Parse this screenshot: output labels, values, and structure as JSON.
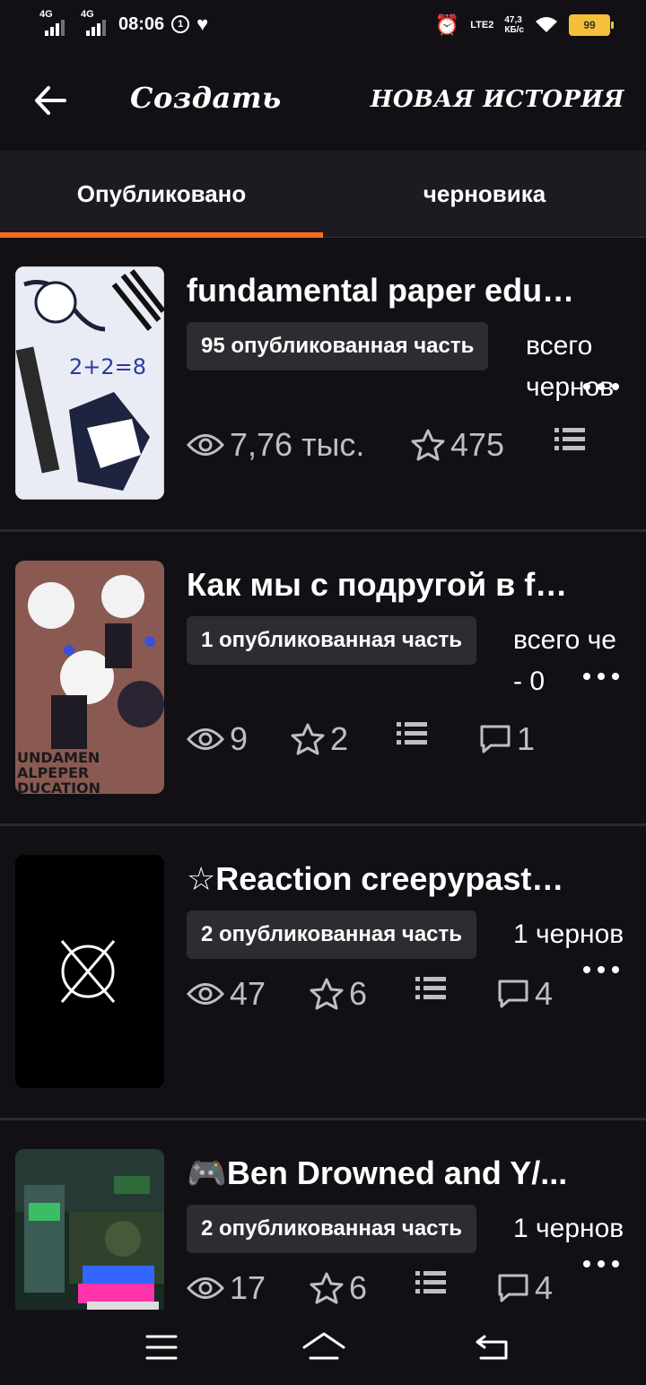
{
  "status_bar": {
    "network_1": "4G",
    "network_2": "4G",
    "time": "08:06",
    "volte": "LTE2",
    "speed_value": "47,3",
    "speed_unit": "КБ/с",
    "battery": "99"
  },
  "app_bar": {
    "title": "Создать",
    "new_story": "НОВАЯ ИСТОРИЯ"
  },
  "tabs": [
    {
      "label": "Опубликовано",
      "selected": true
    },
    {
      "label": "черновика",
      "selected": false
    }
  ],
  "stories": [
    {
      "title": "fundamental paper educ...",
      "published": "95 опубликованная часть",
      "drafts": "всего\nчернов",
      "views": "7,76 тыс.",
      "votes": "475",
      "comments": ""
    },
    {
      "title": "Как мы с подругой в fp...",
      "published": "1 опубликованная часть",
      "drafts": "всего че\n- 0",
      "views": "9",
      "votes": "2",
      "comments": "1"
    },
    {
      "title": "☆Reaction creepypasta ...",
      "published": "2 опубликованная часть",
      "drafts": "1 чернов",
      "views": "47",
      "votes": "6",
      "comments": "4"
    },
    {
      "title": "🎮Ben Drowned and Y/...",
      "published": "2 опубликованная часть",
      "drafts": "1 чернов",
      "views": "17",
      "votes": "6",
      "comments": "4"
    }
  ],
  "colors": {
    "background": "#121015",
    "tab_bar": "#1d1b20",
    "accent": "#ff6a22",
    "badge": "#2e2c31",
    "battery": "#f4c038"
  }
}
